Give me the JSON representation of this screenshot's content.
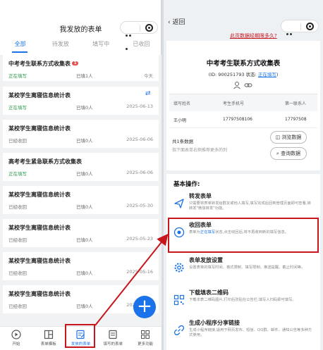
{
  "left": {
    "title": "我发放的表单",
    "tabs": [
      "全部",
      "待发放",
      "填写中",
      "已收回"
    ],
    "cards": [
      {
        "name": "中考考生联系方式收集表",
        "badge": "1",
        "status": "正在填写",
        "status_color": "#2e9b4e",
        "count": "已填1人",
        "date": "今天"
      },
      {
        "name": "某校学生离寝信息统计表",
        "status": "正在填写",
        "status_color": "#2e9b4e",
        "count": "已填0人",
        "date": "2025-06-13",
        "sync": true
      },
      {
        "name": "某校学生离寝信息统计表",
        "status": "已经收回",
        "status_color": "#777777",
        "count": "已填0人",
        "date": "2025-06-06"
      },
      {
        "name": "高考考生紧急联系方式收集表",
        "status": "正在填写",
        "status_color": "#2e9b4e",
        "count": "已填0人",
        "date": "2025-06-06"
      },
      {
        "name": "某校学生离寝信息统计表",
        "status": "已经收回",
        "status_color": "#777777",
        "count": "已填0人",
        "date": "2025-05-30"
      },
      {
        "name": "某校学生离寝信息统计表",
        "status": "已经收回",
        "status_color": "#777777",
        "count": "已填0人",
        "date": "2025-05-23"
      },
      {
        "name": "某校学生离寝信息统计表",
        "status": "已经收回",
        "status_color": "#777777",
        "count": "已填0人",
        "date": "2025-05-16"
      },
      {
        "name": "某校学生离寝信息统计表",
        "status": "已经收回",
        "status_color": "#777777",
        "count": "已填0人",
        "date": "2025-05-09"
      }
    ],
    "bottom_nav": [
      {
        "label": "开始",
        "icon": "play-icon"
      },
      {
        "label": "表单模板",
        "icon": "template-icon"
      },
      {
        "label": "发放的表单",
        "icon": "form-edit-icon",
        "active": true
      },
      {
        "label": "填写的表单",
        "icon": "filled-form-icon"
      },
      {
        "label": "更多功能",
        "icon": "grid-icon"
      }
    ]
  },
  "right": {
    "back_label": "返回",
    "help_link": "此页数据经期限多久?",
    "form_title": "中考考生联系方式收集表",
    "form_id": "(ID: 900251793 状态: ",
    "form_state": "正在填写",
    "form_id_end": ")",
    "table_headers": [
      "填写姓名",
      "考生手机号",
      "第一联系人"
    ],
    "table_row": [
      "王小明",
      "17797508106",
      "17797508"
    ],
    "total": "共1条数据",
    "hint": "指下面表单右侧推荐更多的列",
    "btn_browse": "浏览数据",
    "btn_query": "查询数据",
    "ops_title": "基本操作:",
    "ops": [
      {
        "title": "转发表单",
        "desc": "只需要将表单转发给群友或他人填写,填写完成后回到管理页面即可查看,转转发\"微信转发\"功能。",
        "icon": "send-icon"
      },
      {
        "title": "收回表单",
        "desc_pre": "表单为",
        "desc_hi": "正在填写",
        "desc_post": "状态,点击收回后,将不再收到新的填写信息。",
        "icon": "stop-icon"
      },
      {
        "title": "表单发放设置",
        "desc": "设置表单的填写时间、格式限制、填写限制、推送提醒、截止时间等。",
        "icon": "gear-icon"
      },
      {
        "title": "下载填表二维码",
        "desc": "下载本表二维码图片,打印后张贴在公告栏,填写人扫码即可填写。",
        "icon": "qrcode-icon"
      },
      {
        "title": "生成小程序分享链接",
        "desc": "生成小程序链接,适用于网页发布、短信、QQ群、邮件、通知公告等多种方式使用。",
        "icon": "link-icon"
      }
    ]
  },
  "colors": {
    "accent": "#1a73e8",
    "highlight": "#c8161d"
  }
}
